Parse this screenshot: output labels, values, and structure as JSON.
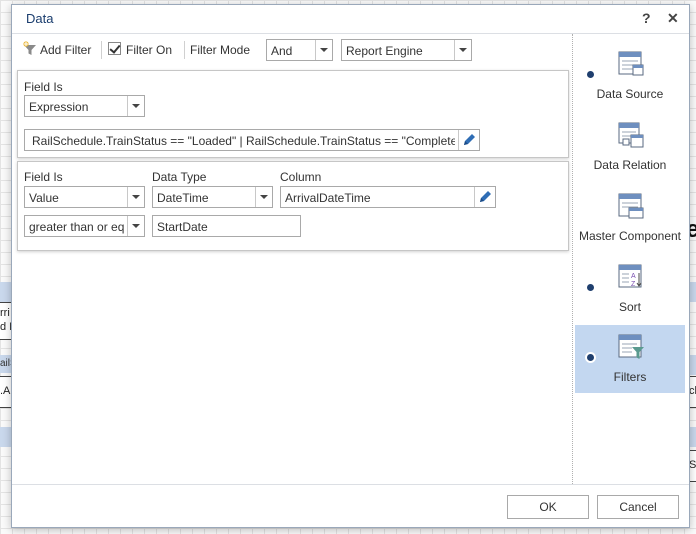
{
  "background": {
    "fragments": [
      "rri",
      "d I",
      "ailS",
      ".Ar",
      "ec",
      "ck",
      "So"
    ]
  },
  "dialog": {
    "title": "Data",
    "help_label": "?",
    "close_label": "✕"
  },
  "toolbar": {
    "add_filter_label": "Add Filter",
    "filter_on_label": "Filter On",
    "filter_on_checked": true,
    "filter_mode_label": "Filter Mode",
    "filter_mode_value": "And",
    "engine_value": "Report Engine"
  },
  "filters": [
    {
      "field_is_label": "Field Is",
      "field_is_value": "Expression",
      "expression": "RailSchedule.TrainStatus == \"Loaded\" | RailSchedule.TrainStatus == \"Completed\""
    },
    {
      "field_is_label": "Field Is",
      "field_is_value": "Value",
      "data_type_label": "Data Type",
      "data_type_value": "DateTime",
      "column_label": "Column",
      "column_value": "ArrivalDateTime",
      "condition_value": "greater than or equal to",
      "value": "StartDate"
    }
  ],
  "sidebar": {
    "items": [
      {
        "label": "Data Source",
        "has_dot": true,
        "active": false,
        "icon": "data-source-icon"
      },
      {
        "label": "Data Relation",
        "has_dot": false,
        "active": false,
        "icon": "data-relation-icon"
      },
      {
        "label": "Master Component",
        "has_dot": false,
        "active": false,
        "icon": "master-component-icon"
      },
      {
        "label": "Sort",
        "has_dot": true,
        "active": false,
        "icon": "sort-icon"
      },
      {
        "label": "Filters",
        "has_dot": true,
        "active": true,
        "icon": "filters-icon"
      }
    ]
  },
  "footer": {
    "ok_label": "OK",
    "cancel_label": "Cancel"
  },
  "colors": {
    "title": "#1a3d6e",
    "active_bg": "#c3d7f0",
    "dot": "#1f3f6e",
    "pencil": "#2f6db5"
  }
}
